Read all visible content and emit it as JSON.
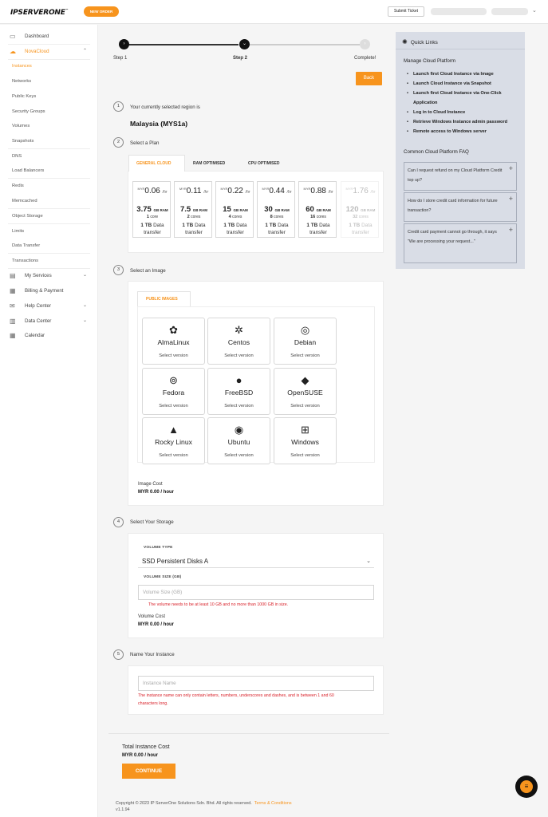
{
  "header": {
    "logo": "IPSERVERONE",
    "logo_mark": "™",
    "new_order": "NEW ORDER",
    "submit_ticket": "Submit Ticket"
  },
  "sidebar": {
    "dashboard": "Dashboard",
    "novacloud": "NovaCloud",
    "sub": [
      "Instances",
      "Networks",
      "Public Keys",
      "Security Groups",
      "Volumes",
      "Snapshots",
      "DNS",
      "Load Balancers",
      "Redis",
      "Memcached",
      "Object Storage",
      "Limits",
      "Data Transfer",
      "Transactions"
    ],
    "my_services": "My Services",
    "billing": "Billing & Payment",
    "help": "Help Center",
    "data_center": "Data Center",
    "calendar": "Calendar"
  },
  "stepper": {
    "step1": "Step 1",
    "step2": "Step 2",
    "complete": "Complete!",
    "back": "Back"
  },
  "region": {
    "num": "1",
    "label": "Your currently selected region is",
    "value": "Malaysia (MYS1a)"
  },
  "plan": {
    "num": "2",
    "title": "Select a Plan",
    "tabs": [
      "GENERAL CLOUD",
      "RAM OPTIMISED",
      "CPU OPTIMISED"
    ],
    "currency": "MYR",
    "per_hr": "/hr",
    "ram_unit": "GB RAM",
    "transfer": "1 TB",
    "transfer_label": "Data transfer",
    "items": [
      {
        "price": "0.06",
        "ram": "3.75",
        "cores_n": "1",
        "cores_u": "core"
      },
      {
        "price": "0.11",
        "ram": "7.5",
        "cores_n": "2",
        "cores_u": "cores"
      },
      {
        "price": "0.22",
        "ram": "15",
        "cores_n": "4",
        "cores_u": "cores"
      },
      {
        "price": "0.44",
        "ram": "30",
        "cores_n": "8",
        "cores_u": "cores"
      },
      {
        "price": "0.88",
        "ram": "60",
        "cores_n": "16",
        "cores_u": "cores"
      },
      {
        "price": "1.76",
        "ram": "120",
        "cores_n": "32",
        "cores_u": "cores"
      }
    ]
  },
  "image": {
    "num": "3",
    "title": "Select an Image",
    "tab": "PUBLIC IMAGES",
    "select_version": "Select version",
    "items": [
      "AlmaLinux",
      "Centos",
      "Debian",
      "Fedora",
      "FreeBSD",
      "OpenSUSE",
      "Rocky Linux",
      "Ubuntu",
      "Windows"
    ],
    "cost_label": "Image Cost",
    "cost_value": "MYR 0.00 / hour"
  },
  "storage": {
    "num": "4",
    "title": "Select Your Storage",
    "type_caption": "VOLUME TYPE",
    "type_value": "SSD Persistent Disks A",
    "size_caption": "VOLUME SIZE (GB)",
    "size_placeholder": "Volume Size (GB)",
    "error": "The volume needs to be at least 10 GB and no more than 1000 GB in size.",
    "cost_label": "Volume Cost",
    "cost_value": "MYR 0.00 / hour"
  },
  "instance": {
    "num": "5",
    "title": "Name Your Instance",
    "placeholder": "Instance Name",
    "error_1": "The instance name can only contain letters, numbers, underscores and dashes, and is between 1 and 60",
    "error_2": "characters long."
  },
  "total": {
    "label": "Total Instance Cost",
    "value": "MYR 0.00 / hour",
    "continue": "CONTINUE"
  },
  "footer": {
    "copyright": "Copyright © 2023 IP ServerOne Solutions Sdn. Bhd. All rights reserved.",
    "terms": "Terms & Conditions",
    "version": "v1.1.94"
  },
  "quick_links": {
    "title": "Quick Links",
    "manage_title": "Manage Cloud Platform",
    "links": [
      "Launch first Cloud Instance via Image",
      "Launch Cloud Instance via Snapshot",
      "Launch first Cloud Instance via One-Click Application",
      "Log in to Cloud Instance",
      "Retrieve Windows Instance admin password",
      "Remote access to Windows server"
    ],
    "faq_title": "Common Cloud Platform FAQ",
    "faqs": [
      "Can I request refund on my Cloud Platform Credit top up?",
      "How do I store credit card information for future transaction?",
      "Credit card payment cannot go through, it says \"We are processing your request...\""
    ]
  },
  "colors": {
    "accent": "#f7941d",
    "error": "#d9222a",
    "panel": "#d9dde6"
  }
}
